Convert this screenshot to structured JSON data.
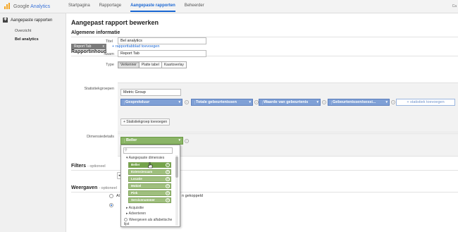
{
  "app": {
    "logo_prefix": "Google",
    "logo_suffix": "Analytics",
    "top_right": "Ca"
  },
  "nav": [
    "Startpagina",
    "Rapportage",
    "Aangepaste rapporten",
    "Beheerder"
  ],
  "sidebar": {
    "header": "Aangepaste rapporten",
    "items": [
      "Overzicht",
      "Bel analytics"
    ]
  },
  "page": {
    "title": "Aangepast rapport bewerken",
    "general_info": "Algemene informatie",
    "title_label": "Titel",
    "title_value": "Bel analytics",
    "report_content": "Rapportinhoud",
    "tab_label": "Report Tab",
    "tab_close": "x",
    "add_tab": "+ rapporttabblad toevoegen",
    "name_label": "Naam",
    "name_value": "Report Tab",
    "type_label": "Type",
    "types": [
      "Verkenner",
      "Platte tabel",
      "Kaartoverlay"
    ],
    "metric_groups_label": "Statistiekgroepen",
    "metric_group_name": "Metric Group",
    "metrics": [
      "Gesprekduur",
      "Totale gebeurtenissen",
      "Waarde van gebeurtenis",
      "Gebeurtenissen/sessi..."
    ],
    "add_metric": "+ statistiek toevoegen",
    "add_metric_group": "+ Statistiekgroep toevoegen",
    "dimension_label": "Dimensiedetails",
    "dimension_value": "Beller",
    "filters": "Filters",
    "filters_opt": "- optioneel",
    "views": "Weergaven",
    "views_opt": "- optioneel",
    "views_option_text": "Al",
    "views_option_suffix": "n gekoppeld"
  },
  "dropdown": {
    "search_placeholder": "",
    "group_custom": "▾ Aangepaste dimensies",
    "options": [
      "Beller",
      "Extensienaam",
      "Locatie",
      "Mobiel",
      "Piek",
      "Servicenummer"
    ],
    "group_acquisition": "▸ Acquisitie",
    "group_ads": "▸ Adverteren",
    "alpha_label": "Weergeven als alfabetische lijst"
  }
}
